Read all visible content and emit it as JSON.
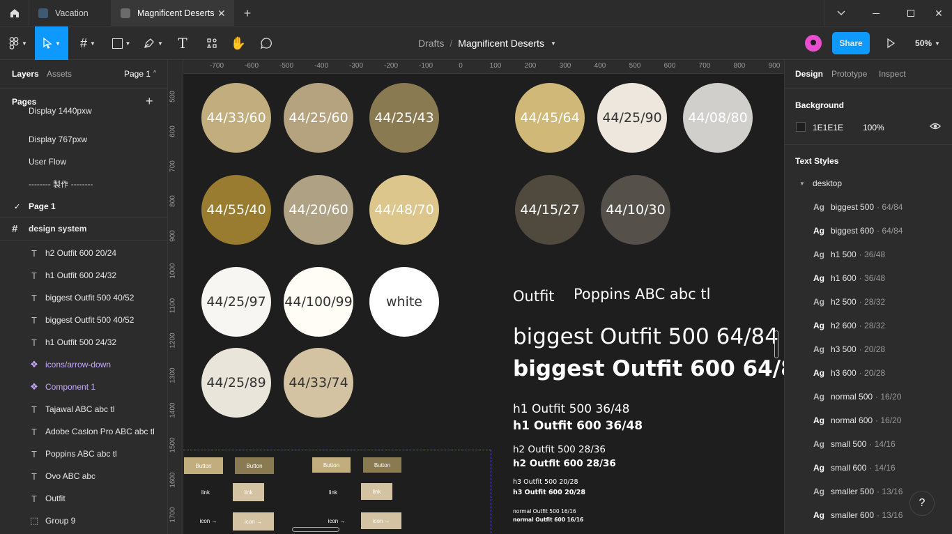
{
  "tabs": [
    {
      "label": "Vacation"
    },
    {
      "label": "Magnificent Deserts"
    }
  ],
  "toolbar": {
    "breadcrumb_parent": "Drafts",
    "breadcrumb_sep": "/",
    "file_name": "Magnificent Deserts",
    "share_label": "Share",
    "zoom": "50%"
  },
  "left": {
    "tab_layers": "Layers",
    "tab_assets": "Assets",
    "page_select": "Page 1",
    "pages_title": "Pages",
    "pages": [
      "Display 1440pxw",
      "Display 767pxw",
      "User Flow",
      "-------- 製作 --------",
      "Page 1"
    ],
    "current_page": "Page 1",
    "frame_name": "design system",
    "layers": [
      {
        "icon": "text-icon",
        "label": "h2 Outfit 600 20/24"
      },
      {
        "icon": "text-icon",
        "label": "h1 Outfit 600 24/32"
      },
      {
        "icon": "text-icon",
        "label": "biggest Outfit 500 40/52"
      },
      {
        "icon": "text-icon",
        "label": "biggest Outfit 500 40/52"
      },
      {
        "icon": "text-icon",
        "label": "h1 Outfit 500 24/32"
      },
      {
        "icon": "component-icon",
        "label": "icons/arrow-down"
      },
      {
        "icon": "component-icon",
        "label": "Component 1"
      },
      {
        "icon": "text-icon",
        "label": "Tajawal ABC abc tl"
      },
      {
        "icon": "text-icon",
        "label": "Adobe Caslon Pro ABC abc tl"
      },
      {
        "icon": "text-icon",
        "label": "Poppins ABC abc tl"
      },
      {
        "icon": "text-icon",
        "label": "Ovo ABC abc"
      },
      {
        "icon": "text-icon",
        "label": "Outfit"
      },
      {
        "icon": "group-icon",
        "label": "Group 9"
      }
    ]
  },
  "ruler": {
    "top": [
      "-700",
      "-600",
      "-500",
      "-400",
      "-300",
      "-200",
      "-100",
      "0",
      "100",
      "200",
      "300",
      "400",
      "500",
      "600",
      "700",
      "800",
      "900"
    ],
    "left": [
      "500",
      "600",
      "700",
      "800",
      "900",
      "1000",
      "1100",
      "1200",
      "1300",
      "1400",
      "1500",
      "1600",
      "1700"
    ]
  },
  "canvas": {
    "swatches": [
      {
        "label": "44/33/60",
        "color": "#c2ad7e",
        "text": "#ffffff"
      },
      {
        "label": "44/25/60",
        "color": "#b5a27f",
        "text": "#ffffff"
      },
      {
        "label": "44/25/43",
        "color": "#8a7a52",
        "text": "#ffffff"
      },
      {
        "label": "44/45/64",
        "color": "#d0b878",
        "text": "#ffffff"
      },
      {
        "label": "44/25/90",
        "color": "#ede7de",
        "text": "#333333"
      },
      {
        "label": "44/08/80",
        "color": "#d0cfcc",
        "text": "#ffffff"
      },
      {
        "label": "44/55/40",
        "color": "#9a7c30",
        "text": "#ffffff"
      },
      {
        "label": "44/20/60",
        "color": "#aea184",
        "text": "#ffffff"
      },
      {
        "label": "44/48/70",
        "color": "#dcc68c",
        "text": "#ffffff"
      },
      {
        "label": "44/15/27",
        "color": "#4f493e",
        "text": "#ffffff"
      },
      {
        "label": "44/10/30",
        "color": "#555049",
        "text": "#ffffff"
      },
      {
        "label": "44/25/97",
        "color": "#f8f6f2",
        "text": "#333333"
      },
      {
        "label": "44/100/99",
        "color": "#fffdf5",
        "text": "#333333"
      },
      {
        "label": "white",
        "color": "#ffffff",
        "text": "#333333"
      },
      {
        "label": "44/25/89",
        "color": "#eae5db",
        "text": "#333333"
      },
      {
        "label": "44/33/74",
        "color": "#d3c3a2",
        "text": "#333333"
      }
    ],
    "font_outfit": "Outfit",
    "font_poppins": "Poppins ABC abc tl",
    "type_samples": [
      "biggest Outfit 500 64/84",
      "biggest Outfit 600 64/84",
      "h1 Outfit 500 36/48",
      "h1 Outfit 600 36/48",
      "h2 Outfit 500 28/36",
      "h2 Outfit 600 28/36",
      "h3 Outfit 500 20/28",
      "h3 Outfit 600 20/28",
      "normal Outfit 500 16/16",
      "normal Outfit 600 16/16"
    ],
    "components": {
      "button": "Button",
      "link": "link",
      "icon": "icon →"
    }
  },
  "right": {
    "tab_design": "Design",
    "tab_prototype": "Prototype",
    "tab_inspect": "Inspect",
    "background_title": "Background",
    "bg_hex": "1E1E1E",
    "bg_opacity": "100%",
    "text_styles_title": "Text Styles",
    "group": "desktop",
    "styles": [
      {
        "name": "biggest 500",
        "spec": "· 64/84"
      },
      {
        "name": "biggest 600",
        "spec": "· 64/84"
      },
      {
        "name": "h1 500",
        "spec": "· 36/48"
      },
      {
        "name": "h1 600",
        "spec": "· 36/48"
      },
      {
        "name": "h2 500",
        "spec": "· 28/32"
      },
      {
        "name": "h2 600",
        "spec": "· 28/32"
      },
      {
        "name": "h3 500",
        "spec": "· 20/28"
      },
      {
        "name": "h3 600",
        "spec": "· 20/28"
      },
      {
        "name": "normal 500",
        "spec": "· 16/20"
      },
      {
        "name": "normal 600",
        "spec": "· 16/20"
      },
      {
        "name": "small 500",
        "spec": "· 14/16"
      },
      {
        "name": "small 600",
        "spec": "· 14/16"
      },
      {
        "name": "smaller 500",
        "spec": "· 13/16"
      },
      {
        "name": "smaller 600",
        "spec": "· 13/16"
      }
    ],
    "ag": "Ag",
    "help": "?"
  },
  "colors": {
    "accent": "#0d99ff",
    "avatar": "#e84fd0"
  }
}
